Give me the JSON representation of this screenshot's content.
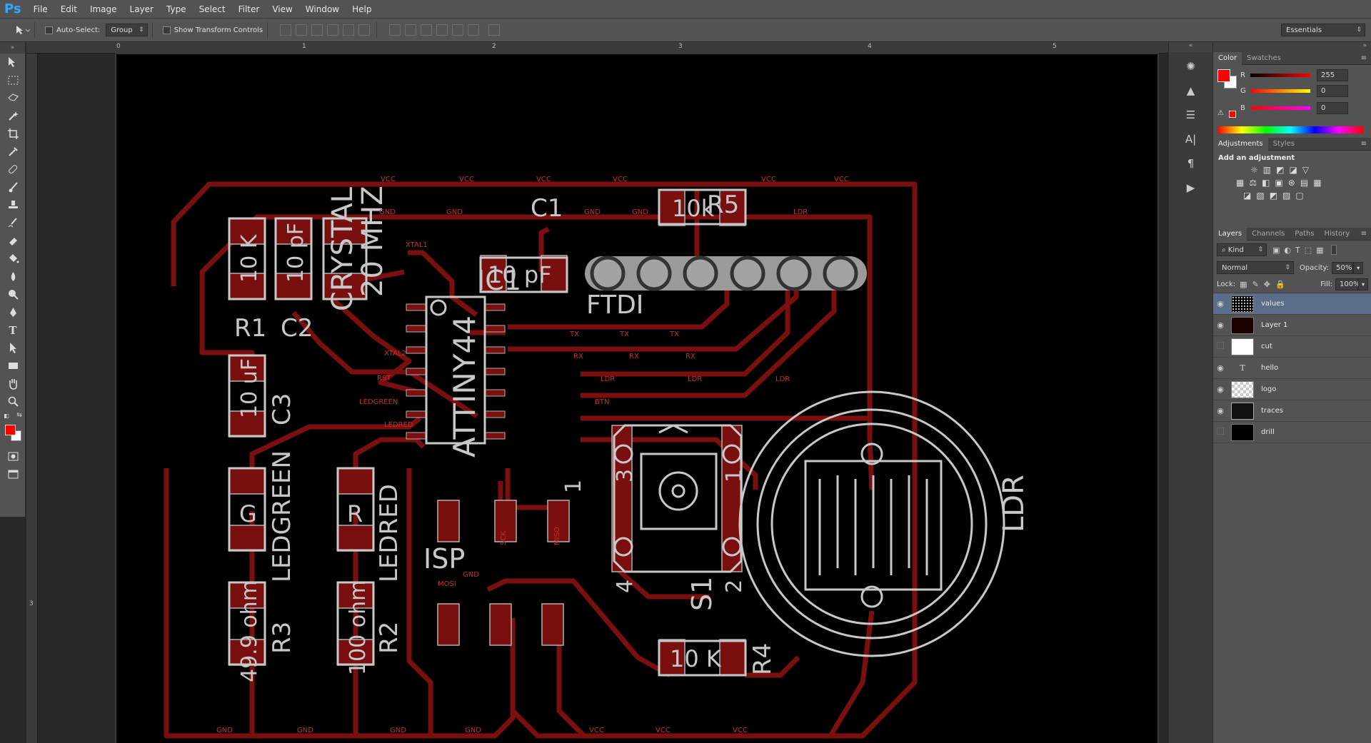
{
  "app": {
    "logo": "Ps"
  },
  "menu": [
    "File",
    "Edit",
    "Image",
    "Layer",
    "Type",
    "Select",
    "Filter",
    "View",
    "Window",
    "Help"
  ],
  "options": {
    "auto_select": "Auto-Select:",
    "group": "Group",
    "show_transform": "Show Transform Controls",
    "workspace": "Essentials"
  },
  "rulers": {
    "top": [
      "0",
      "1",
      "2",
      "3",
      "4",
      "5"
    ],
    "left": [
      "3"
    ]
  },
  "colors": {
    "foreground": "#ff0000",
    "background": "#ffffff",
    "trace": "#8a1010",
    "silk": "#d0d0d0",
    "pad": "#aaaaaa"
  },
  "color_panel": {
    "tabs": [
      "Color",
      "Swatches"
    ],
    "r": "255",
    "g": "0",
    "b": "0",
    "labels": [
      "R",
      "G",
      "B"
    ]
  },
  "adjustments": {
    "tabs": [
      "Adjustments",
      "Styles"
    ],
    "title": "Add an adjustment"
  },
  "layers_panel": {
    "tabs": [
      "Layers",
      "Channels",
      "Paths",
      "History"
    ],
    "kind": "Kind",
    "blend": "Normal",
    "opacity_label": "Opacity:",
    "opacity": "50%",
    "lock_label": "Lock:",
    "fill_label": "Fill:",
    "fill": "100%",
    "layers": [
      {
        "name": "values",
        "visible": true,
        "selected": true
      },
      {
        "name": "Layer 1",
        "visible": true,
        "selected": false
      },
      {
        "name": "cut",
        "visible": false,
        "selected": false
      },
      {
        "name": "hello",
        "visible": true,
        "selected": false
      },
      {
        "name": "logo",
        "visible": true,
        "selected": false
      },
      {
        "name": "traces",
        "visible": true,
        "selected": false
      },
      {
        "name": "drill",
        "visible": false,
        "selected": false
      }
    ]
  },
  "pcb": {
    "big_labels": [
      "R1",
      "C2",
      "CRYSTAL",
      "20 MHZ",
      "C1",
      "IC1",
      "ATTINY44",
      "FTDI",
      "R5",
      "10k",
      "10 pF",
      "10 K",
      "10 pF",
      "C3",
      "10 uF",
      "LEDGREEN",
      "G",
      "LEDRED",
      "R",
      "R3",
      "49.9 ohm",
      "R2",
      "100 ohm",
      "ISP",
      "S1",
      "R4",
      "10 K",
      "LDR",
      "1",
      "3",
      "1",
      "4",
      "2"
    ],
    "net_labels": [
      "VCC",
      "VCC",
      "VCC",
      "VCC",
      "VCC",
      "VCC",
      "GND",
      "GND",
      "GND",
      "GND",
      "LDR",
      "TX",
      "TX",
      "TX",
      "RX",
      "RX",
      "RX",
      "LDR",
      "LDR",
      "LDR",
      "BTN",
      "XTAL2",
      "RST",
      "LEDGREEN",
      "LEDRED",
      "MOSI",
      "GND",
      "GND",
      "GND",
      "GND",
      "GND",
      "VCC",
      "VCC",
      "VCC",
      "XTAL1",
      "MISO",
      "SCK"
    ]
  }
}
